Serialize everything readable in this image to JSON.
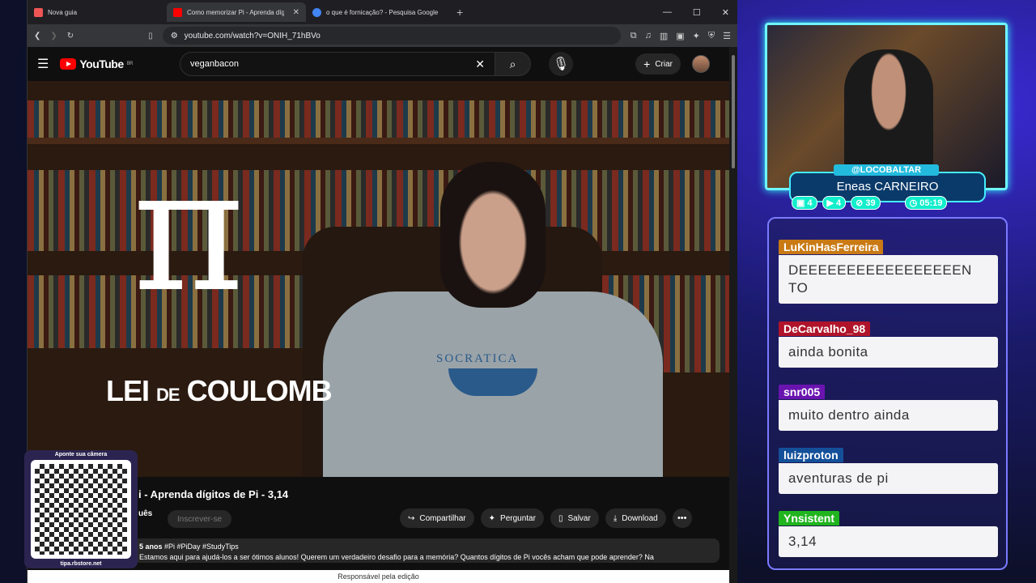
{
  "browser": {
    "tabs": [
      {
        "title": "Nova guia",
        "color": "#e55"
      },
      {
        "title": "Como memorizar Pi - Aprenda díg",
        "color": "#f00"
      },
      {
        "title": "o que é fornicação? - Pesquisa Google",
        "color": "#4285f4"
      }
    ],
    "url": "youtube.com/watch?v=ONIH_71hBVo"
  },
  "youtube": {
    "logo": "YouTube",
    "region": "BR",
    "search_value": "veganbacon",
    "create_label": "Criar",
    "video_overlay_title": "LEI",
    "video_overlay_de": "DE",
    "video_overlay_name": "COULOMB",
    "hoodie_text": "SOCRATICA",
    "video_title": "i - Aprenda dígitos de Pi - 3,14",
    "channel_fragment": "uês",
    "subscribe_label": "Inscrever-se",
    "share_label": "Compartilhar",
    "ask_label": "Perguntar",
    "save_label": "Salvar",
    "download_label": "Download",
    "desc_meta": "5 anos",
    "desc_tags": "#Pi #PiDay #StudyTips",
    "desc_text": "Estamos aqui para ajudá-los a ser ótimos alunos! Querem um verdadeiro desafio para a memória? Quantos dígitos de Pi vocês acham que pode aprender? Na",
    "footer": "Responsável pela edição"
  },
  "qr": {
    "title": "Aponte sua câmera",
    "url": "tipa.rbstore.net"
  },
  "stream": {
    "handle": "@LOCOBALTAR",
    "name": "Eneas CARNEIRO",
    "stat1": "4",
    "stat2": "4",
    "stat3": "39",
    "clock": "05:19"
  },
  "chat": [
    {
      "user": "LuKinHasFerreira",
      "text": "DEEEEEEEEEEEEEEEEEN TO",
      "color": "#c97a14"
    },
    {
      "user": "DeCarvalho_98",
      "text": "ainda bonita",
      "color": "#b0142a"
    },
    {
      "user": "snr005",
      "text": "muito dentro ainda",
      "color": "#6a14b0"
    },
    {
      "user": "luizproton",
      "text": "aventuras de pi",
      "color": "#14509a"
    },
    {
      "user": "Ynsistent",
      "text": "3,14",
      "color": "#20b41e"
    }
  ]
}
